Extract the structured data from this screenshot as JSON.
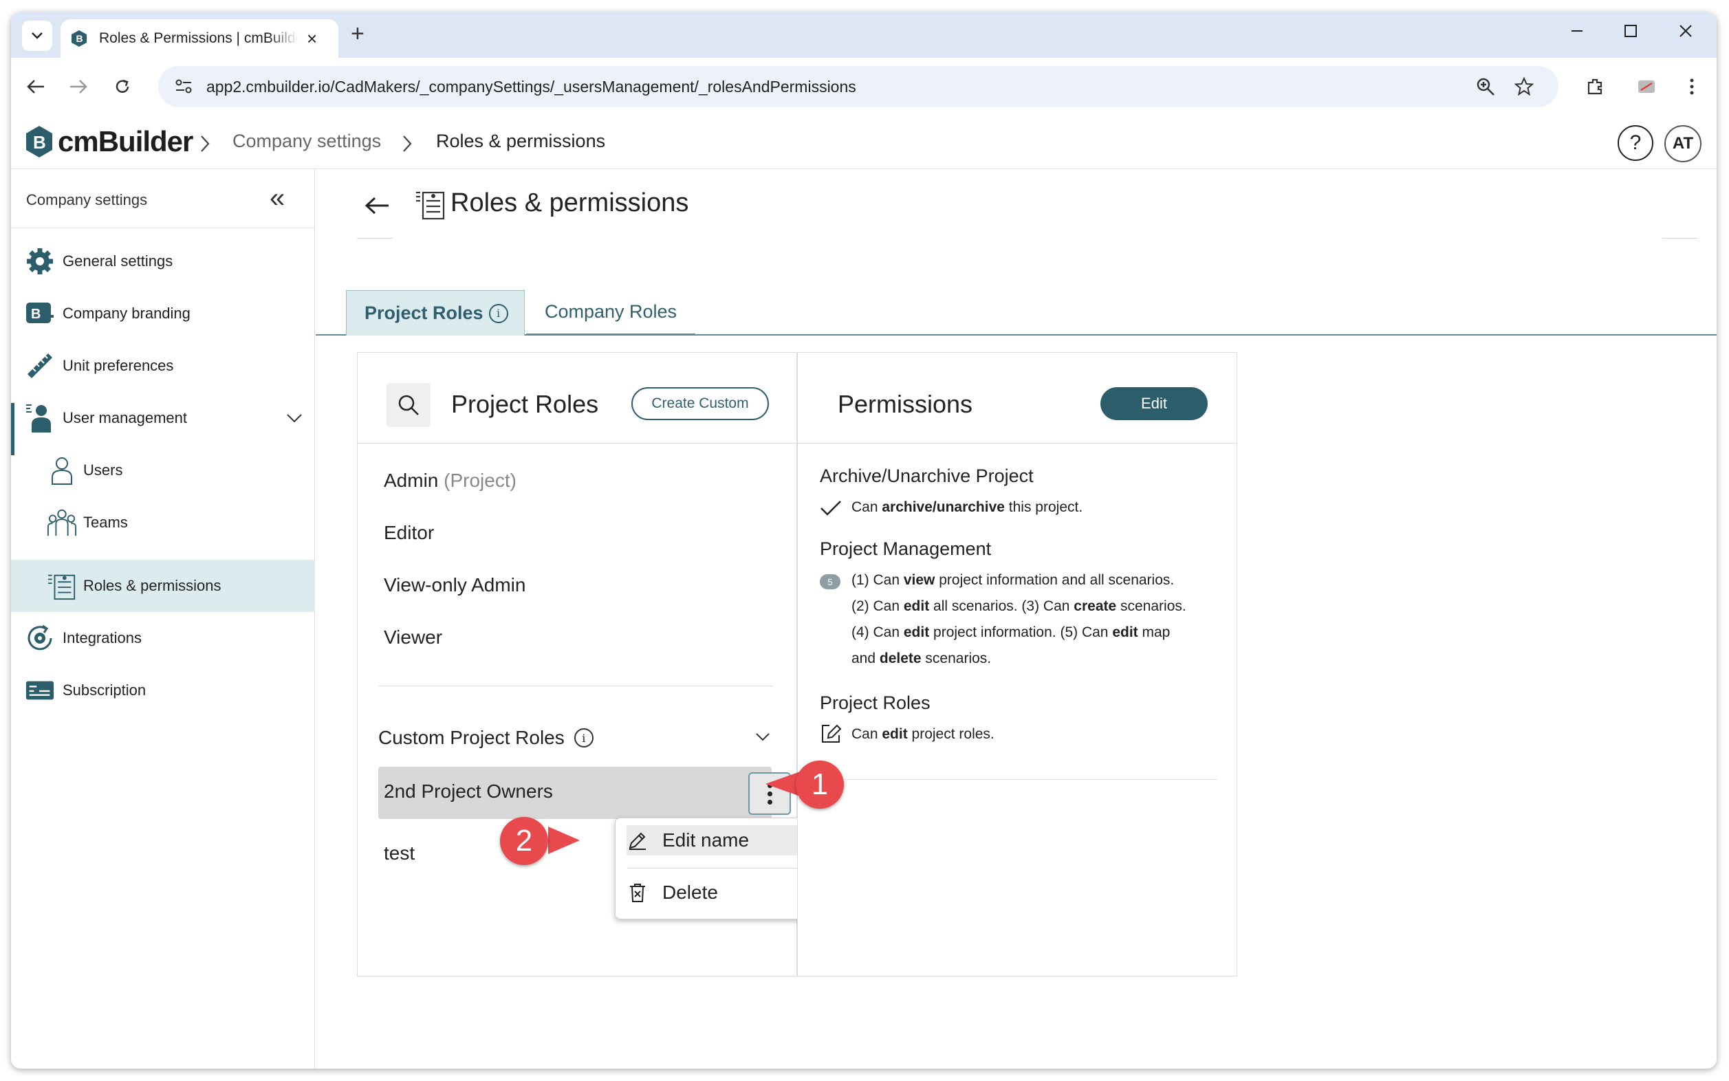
{
  "browser": {
    "tab_title": "Roles & Permissions | cmBuilder",
    "url": "app2.cmbuilder.io/CadMakers/_companySettings/_usersManagement/_rolesAndPermissions"
  },
  "header": {
    "logo_text": "cmBuilder",
    "breadcrumb": [
      "Company settings",
      "Roles & permissions"
    ],
    "help_label": "?",
    "avatar_initials": "AT"
  },
  "sidebar": {
    "title": "Company settings",
    "items": [
      {
        "label": "General settings",
        "icon": "gear-icon"
      },
      {
        "label": "Company branding",
        "icon": "branding-icon"
      },
      {
        "label": "Unit preferences",
        "icon": "ruler-icon"
      },
      {
        "label": "User management",
        "icon": "user-management-icon"
      },
      {
        "label": "Users",
        "icon": "user-icon"
      },
      {
        "label": "Teams",
        "icon": "team-icon"
      },
      {
        "label": "Roles & permissions",
        "icon": "roles-icon"
      },
      {
        "label": "Integrations",
        "icon": "integrations-icon"
      },
      {
        "label": "Subscription",
        "icon": "subscription-icon"
      }
    ]
  },
  "main": {
    "title": "Roles & permissions",
    "tabs": [
      {
        "label": "Project Roles",
        "active": true
      },
      {
        "label": "Company Roles",
        "active": false
      }
    ],
    "roles_panel": {
      "title": "Project Roles",
      "create_label": "Create Custom",
      "default_roles": [
        {
          "name": "Admin",
          "suffix": "(Project)"
        },
        {
          "name": "Editor",
          "suffix": ""
        },
        {
          "name": "View-only Admin",
          "suffix": ""
        },
        {
          "name": "Viewer",
          "suffix": ""
        }
      ],
      "custom_title": "Custom Project Roles",
      "custom_roles": [
        "2nd Project Owners",
        "test"
      ],
      "menu": {
        "edit_label": "Edit name",
        "delete_label": "Delete"
      }
    },
    "permissions_panel": {
      "title": "Permissions",
      "edit_label": "Edit",
      "sections": [
        {
          "heading": "Archive/Unarchive Project",
          "pre": "Can ",
          "bold": "archive/unarchive",
          "post": " this project."
        },
        {
          "heading": "Project Management",
          "badge": "5",
          "l1a": "(1) Can ",
          "l1b": "view",
          "l1c": " project information and all scenarios.",
          "l2a": "(2) Can ",
          "l2b": "edit",
          "l2c": " all scenarios. (3) Can ",
          "l2d": "create",
          "l2e": " scenarios.",
          "l3a": "(4) Can ",
          "l3b": "edit",
          "l3c": " project information. (5) Can ",
          "l3d": "edit",
          "l3e": " map",
          "l4a": "and ",
          "l4b": "delete",
          "l4c": " scenarios."
        },
        {
          "heading": "Project Roles",
          "pre": "Can ",
          "bold": "edit",
          "post": " project roles."
        }
      ]
    }
  },
  "callouts": [
    "1",
    "2"
  ],
  "colors": {
    "accent": "#2c5d6b",
    "active_bg": "#dcebee",
    "callout": "#e8494c"
  }
}
